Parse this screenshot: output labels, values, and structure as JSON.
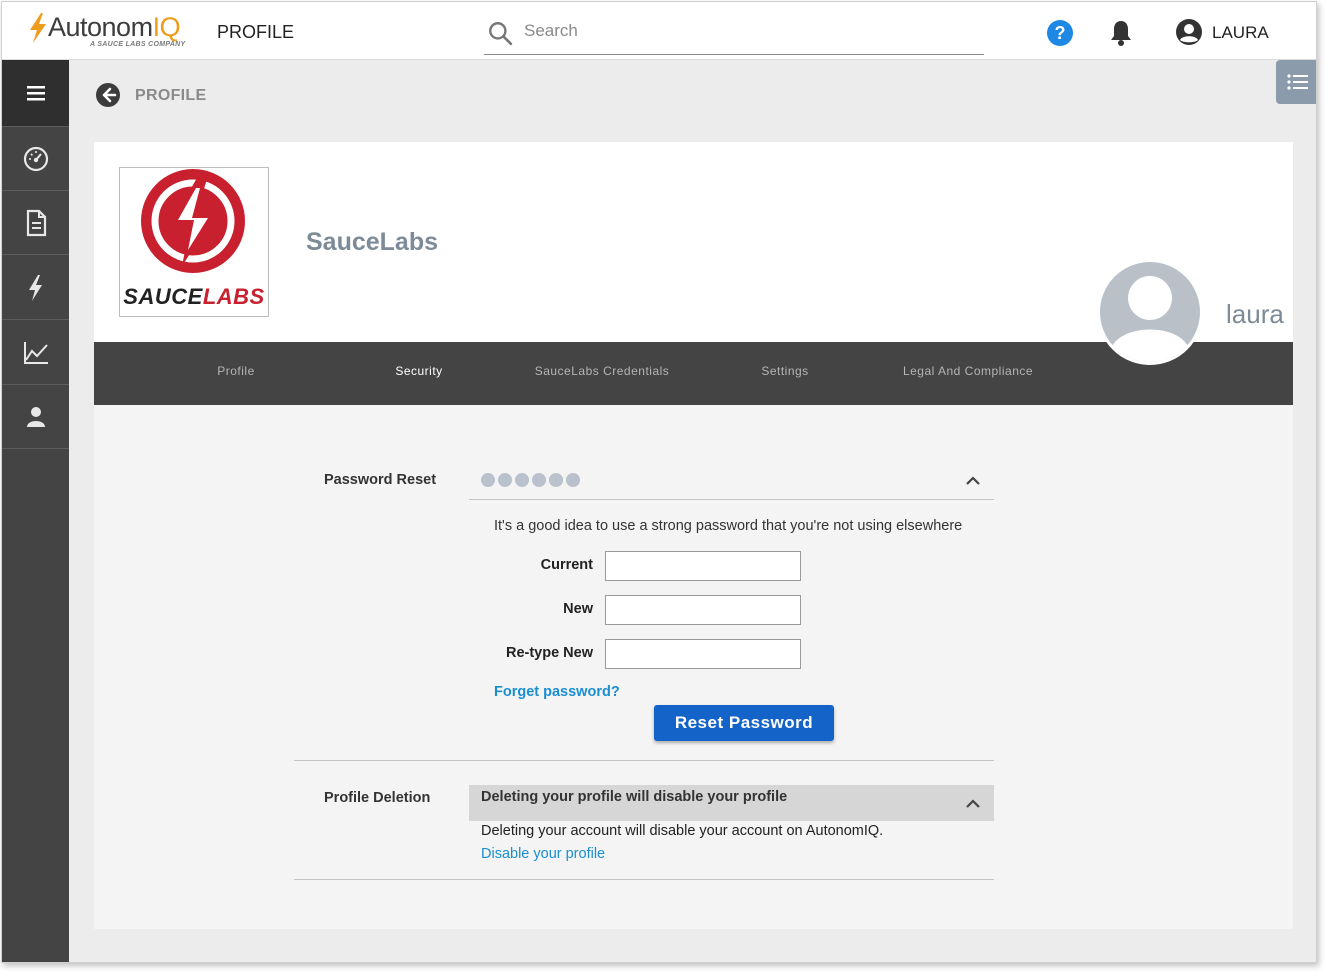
{
  "header": {
    "brand_main": "Autonom",
    "brand_accent": "IQ",
    "brand_sub": "A SAUCE LABS COMPANY",
    "page_label": "PROFILE",
    "search_placeholder": "Search",
    "user_name": "LAURA"
  },
  "breadcrumb": {
    "title": "PROFILE"
  },
  "sidebar": {
    "items": [
      {
        "name": "menu",
        "icon": "hamburger-icon"
      },
      {
        "name": "dashboard",
        "icon": "speedometer-icon"
      },
      {
        "name": "documents",
        "icon": "document-icon"
      },
      {
        "name": "executions",
        "icon": "lightning-icon"
      },
      {
        "name": "reports",
        "icon": "line-chart-icon"
      },
      {
        "name": "users",
        "icon": "person-icon"
      }
    ]
  },
  "profile": {
    "org_logo_word_a": "SAUCE",
    "org_logo_word_b": "LABS",
    "org_name": "SauceLabs",
    "username": "laura"
  },
  "tabs": [
    {
      "label": "Profile",
      "active": false
    },
    {
      "label": "Security",
      "active": true
    },
    {
      "label": "SauceLabs Credentials",
      "active": false
    },
    {
      "label": "Settings",
      "active": false
    },
    {
      "label": "Legal And Compliance",
      "active": false
    }
  ],
  "password_reset": {
    "label": "Password Reset",
    "masked_dots": 6,
    "hint": "It's a good idea to use a strong password that you're not using elsewhere",
    "current_label": "Current",
    "current_value": "",
    "new_label": "New",
    "new_value": "",
    "retype_label": "Re-type New",
    "retype_value": "",
    "forget_link": "Forget password?",
    "submit_label": "Reset Password"
  },
  "profile_deletion": {
    "label": "Profile Deletion",
    "header": "Deleting your profile will disable your profile",
    "body": "Deleting your account will disable your account on AutonomIQ.",
    "link": "Disable your profile"
  },
  "colors": {
    "accent_blue": "#1463c9",
    "link_blue": "#1a8fd0",
    "sidebar": "#444444",
    "brand_orange": "#ef9b1c",
    "sauce_red": "#c8202e"
  }
}
